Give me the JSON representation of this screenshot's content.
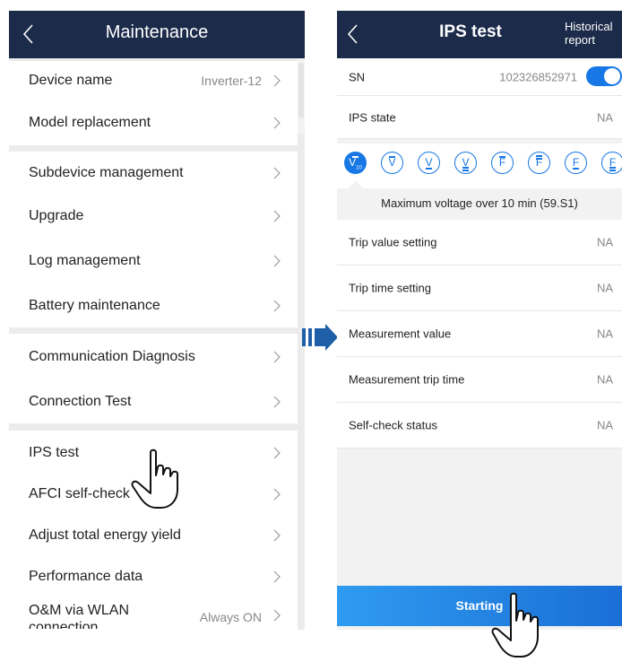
{
  "left": {
    "header": {
      "title": "Maintenance"
    },
    "rows": [
      {
        "label": "Device name",
        "value": "Inverter-12"
      },
      {
        "label": "Model replacement",
        "value": ""
      },
      {
        "label": "Subdevice management",
        "value": ""
      },
      {
        "label": "Upgrade",
        "value": ""
      },
      {
        "label": "Log management",
        "value": ""
      },
      {
        "label": "Battery maintenance",
        "value": ""
      },
      {
        "label": "Communication Diagnosis",
        "value": ""
      },
      {
        "label": "Connection Test",
        "value": ""
      },
      {
        "label": "IPS test",
        "value": ""
      },
      {
        "label": "AFCI self-check",
        "value": ""
      },
      {
        "label": "Adjust total energy yield",
        "value": ""
      },
      {
        "label": "Performance data",
        "value": ""
      },
      {
        "label": "O&M via WLAN connection",
        "value": "Always ON"
      }
    ]
  },
  "right": {
    "header": {
      "title": "IPS test",
      "historical": "Historical report"
    },
    "sn": {
      "label": "SN",
      "value": "102326852971",
      "toggle_on": true
    },
    "ips_state": {
      "label": "IPS state",
      "value": "NA"
    },
    "tabs": [
      "V10",
      "V",
      "V",
      "V",
      "F",
      "F",
      "F",
      "F"
    ],
    "active_tab": 0,
    "description": "Maximum voltage over 10 min (59.S1)",
    "rows": [
      {
        "label": "Trip value setting",
        "value": "NA"
      },
      {
        "label": "Trip time setting",
        "value": "NA"
      },
      {
        "label": "Measurement value",
        "value": "NA"
      },
      {
        "label": "Measurement trip time",
        "value": "NA"
      },
      {
        "label": "Self-check status",
        "value": "NA"
      }
    ],
    "start_button": "Starting"
  },
  "colors": {
    "header": "#1c2b4a",
    "accent": "#1677e5",
    "arrow": "#1f5fa8"
  },
  "icons": [
    "back-chevron-icon",
    "right-chevron-icon",
    "pointing-hand-icon",
    "flow-arrow-icon"
  ]
}
